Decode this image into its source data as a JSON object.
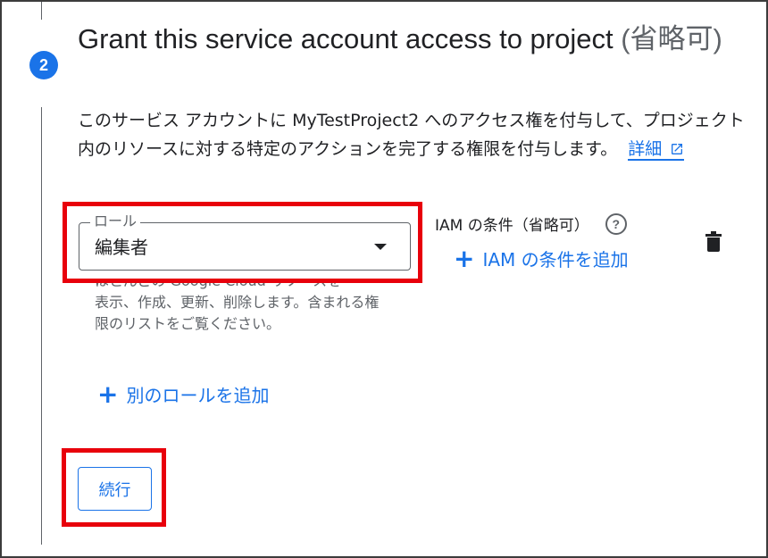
{
  "step": {
    "number": "2",
    "title": "Grant this service account access to project",
    "title_optional": "(省略可)",
    "description": "このサービス アカウントに MyTestProject2 へのアクセス権を付与して、プロジェクト内のリソースに対する特定のアクションを完了する権限を付与します。",
    "details_link": "詳細"
  },
  "role_field": {
    "legend": "ロール",
    "value": "編集者",
    "hint_cut_line": "ほとんどの Google Cloud リソースを",
    "hint": "表示、作成、更新、削除します。含まれる権限のリストをご覧ください。"
  },
  "iam_condition": {
    "label": "IAM の条件（省略可）",
    "help_icon": "?",
    "add_label": "IAM の条件を追加"
  },
  "add_role_label": "別のロールを追加",
  "continue_label": "続行",
  "colors": {
    "accent": "#1a73e8",
    "highlight": "#e8000b",
    "text": "#202124",
    "secondary_text": "#5f6368"
  },
  "icons": {
    "step": "step-number-circle",
    "external_link": "external-link-icon",
    "dropdown": "dropdown-arrow-icon",
    "help": "help-circle-icon",
    "add": "plus-icon",
    "delete": "trash-icon"
  }
}
